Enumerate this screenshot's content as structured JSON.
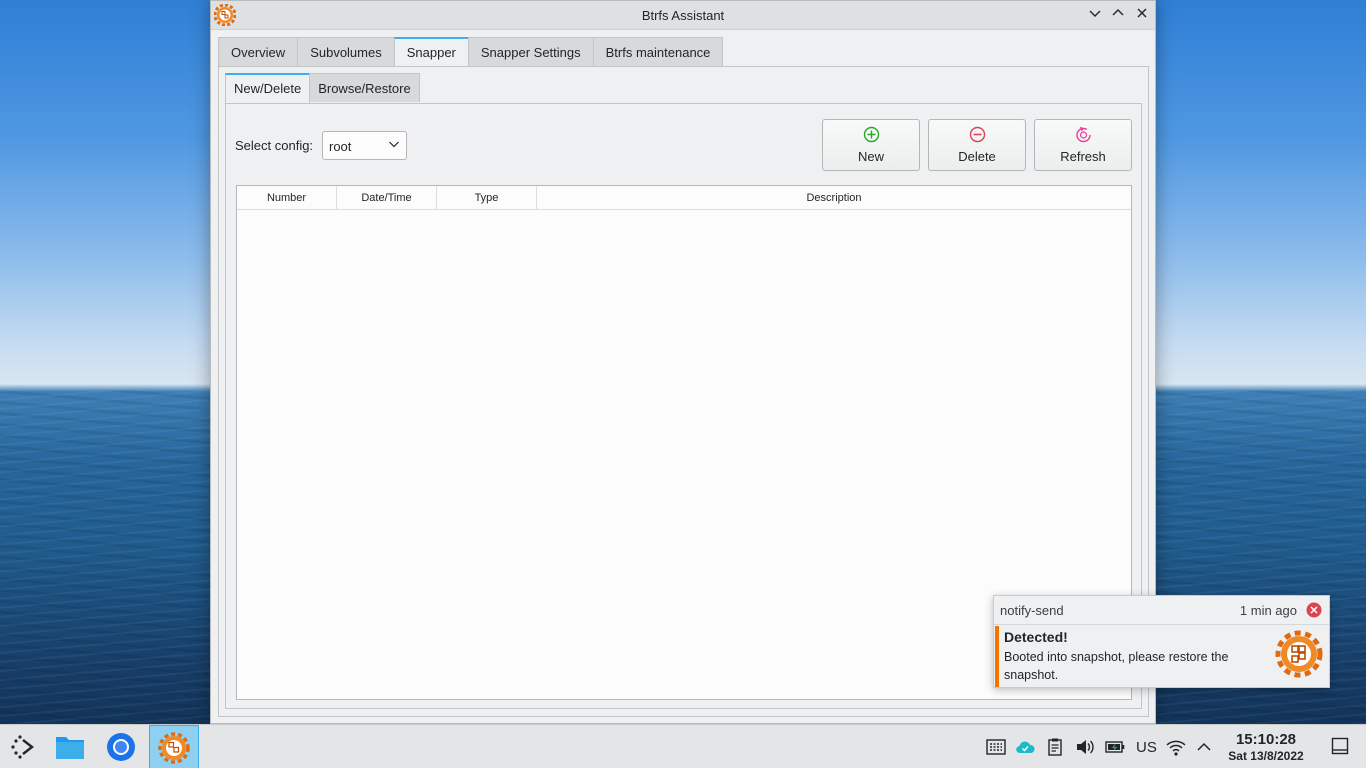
{
  "window": {
    "title": "Btrfs Assistant",
    "controls": [
      "minimize",
      "maximize",
      "close"
    ]
  },
  "main_tabs": [
    {
      "label": "Overview",
      "active": false
    },
    {
      "label": "Subvolumes",
      "active": false
    },
    {
      "label": "Snapper",
      "active": true
    },
    {
      "label": "Snapper Settings",
      "active": false
    },
    {
      "label": "Btrfs maintenance",
      "active": false
    }
  ],
  "sub_tabs": [
    {
      "label": "New/Delete",
      "active": true
    },
    {
      "label": "Browse/Restore",
      "active": false
    }
  ],
  "config": {
    "label": "Select config:",
    "value": "root"
  },
  "actions": {
    "new_label": "New",
    "delete_label": "Delete",
    "refresh_label": "Refresh"
  },
  "table": {
    "columns": [
      "Number",
      "Date/Time",
      "Type",
      "Description"
    ],
    "rows": []
  },
  "notification": {
    "app": "notify-send",
    "time": "1 min ago",
    "title": "Detected!",
    "body": "Booted into snapshot, please restore the snapshot.",
    "accent_color": "#f67400"
  },
  "taskbar": {
    "apps": [
      "application-launcher-icon",
      "file-manager-icon",
      "chromium-icon",
      "btrfs-assistant-icon"
    ],
    "tray": [
      "keyboard-icon",
      "cloud-sync-icon",
      "clipboard-icon",
      "volume-icon",
      "battery-icon"
    ],
    "keyboard_layout": "US",
    "clock_time": "15:10:28",
    "clock_date": "Sat 13/8/2022"
  },
  "colors": {
    "accent": "#3daee9",
    "window_bg": "#eff0f1",
    "new_icon": "#27a628",
    "delete_icon": "#da4453",
    "refresh_icon": "#e93d9e"
  }
}
